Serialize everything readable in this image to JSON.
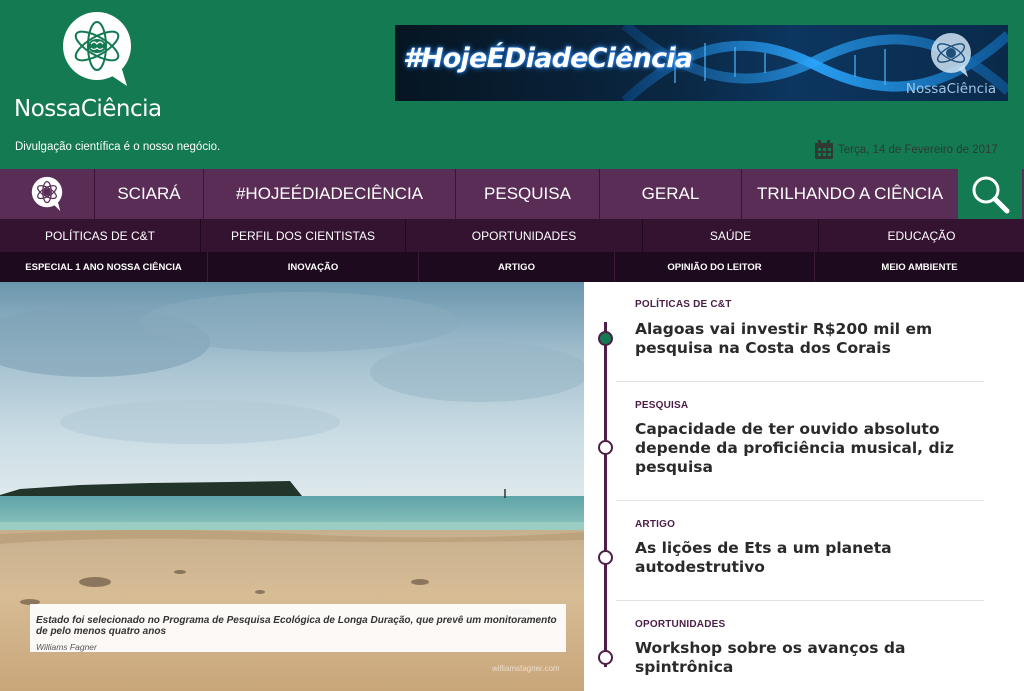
{
  "header": {
    "logo_text": "NossaCiência",
    "tagline": "Divulgação científica é o nosso negócio.",
    "banner_text": "#HojeÉDiadeCiência",
    "banner_logo_text": "NossaCiência",
    "date": "Terça, 14 de Fevereiro de 2017"
  },
  "nav_primary": [
    "SCIARÁ",
    "#HOJEÉDIADECIÊNCIA",
    "PESQUISA",
    "GERAL",
    "TRILHANDO A CIÊNCIA"
  ],
  "nav_secondary": [
    "POLÍTICAS DE C&T",
    "PERFIL DOS CIENTISTAS",
    "OPORTUNIDADES",
    "SAÚDE",
    "EDUCAÇÃO"
  ],
  "nav_tertiary": [
    "ESPECIAL 1 ANO NOSSA CIÊNCIA",
    "INOVAÇÃO",
    "ARTIGO",
    "OPINIÃO DO LEITOR",
    "MEIO AMBIENTE"
  ],
  "hero": {
    "caption": "Estado foi selecionado no Programa de Pesquisa Ecológica de Longa Duração, que prevê um monitoramento de pelo menos quatro anos",
    "credit": "Williams Fagner",
    "watermark": "williamsfagner.com"
  },
  "articles": [
    {
      "category": "POLÍTICAS DE C&T",
      "title": "Alagoas vai investir R$200 mil em pesquisa na Costa dos Corais",
      "active": true
    },
    {
      "category": "PESQUISA",
      "title": "Capacidade de ter ouvido absoluto depende da proficiência musical, diz pesquisa",
      "active": false
    },
    {
      "category": "ARTIGO",
      "title": "As lições de Ets a um planeta autodestrutivo",
      "active": false
    },
    {
      "category": "OPORTUNIDADES",
      "title": "Workshop sobre os avanços da spintrônica",
      "active": false
    }
  ],
  "icons": {
    "logo": "atom-brain-chat-icon",
    "calendar": "calendar-icon",
    "search": "search-icon",
    "home": "home-logo-icon"
  },
  "colors": {
    "header_green": "#137a52",
    "nav_purple": "#5a2d57",
    "nav_dark": "#341331",
    "nav_darker": "#1e0a1e"
  }
}
